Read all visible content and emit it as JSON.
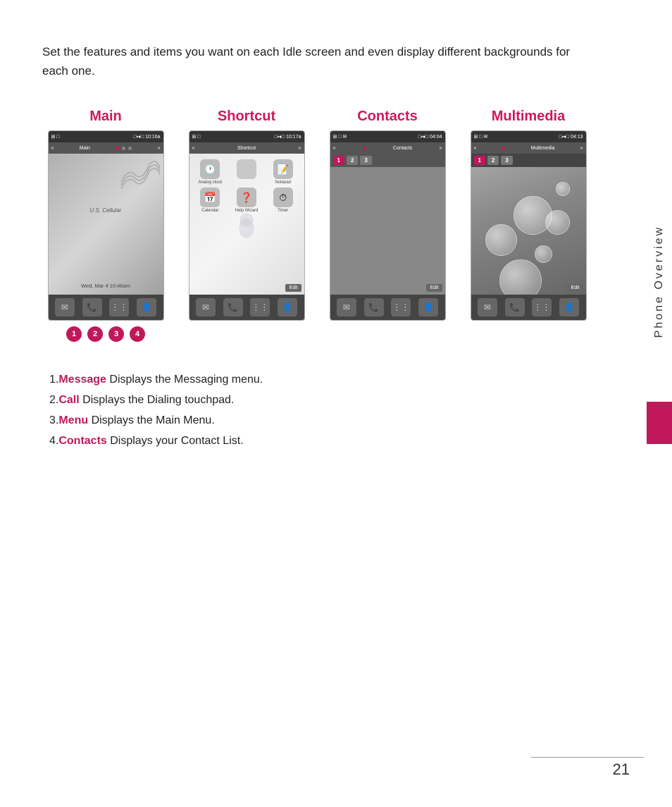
{
  "intro": {
    "text": "Set the features and items you want on each Idle screen and even display different backgrounds for each one."
  },
  "screens": [
    {
      "id": "main",
      "label": "Main",
      "type": "main",
      "status_left": "⊞ □",
      "status_right": "□▪♦□ 10:16a",
      "nav_label": "Main",
      "content_line1": "U.S. Cellular",
      "content_line2": "Wed, Mar 4  10:46am",
      "show_circles": true
    },
    {
      "id": "shortcut",
      "label": "Shortcut",
      "type": "shortcut",
      "status_right": "10:17a",
      "nav_label": "Shortcut",
      "apps": [
        {
          "icon": "🕐",
          "label": "Analog clock"
        },
        {
          "icon": "📝",
          "label": "Timer"
        },
        {
          "icon": "📔",
          "label": "Notepad"
        },
        {
          "icon": "📅",
          "label": "Calendar"
        },
        {
          "icon": "❓",
          "label": "Help Wizard"
        }
      ]
    },
    {
      "id": "contacts",
      "label": "Contacts",
      "type": "contacts",
      "status_right": "04:04",
      "nav_label": "Contacts",
      "tabs": [
        "1",
        "2",
        "3"
      ]
    },
    {
      "id": "multimedia",
      "label": "Multimedia",
      "type": "multimedia",
      "status_right": "04:13",
      "nav_label": "Multimedia",
      "tabs": [
        "1",
        "2",
        "3"
      ]
    }
  ],
  "circles": [
    "1",
    "2",
    "3",
    "4"
  ],
  "legend": [
    {
      "number": "1",
      "label": "Message",
      "description": " Displays the Messaging menu."
    },
    {
      "number": "2",
      "label": "Call",
      "description": " Displays the Dialing touchpad."
    },
    {
      "number": "3",
      "label": "Menu",
      "description": " Displays the Main Menu."
    },
    {
      "number": "4",
      "label": "Contacts",
      "description": " Displays your Contact List."
    }
  ],
  "side_label": "Phone Overview",
  "page_number": "21",
  "accent_color": "#c0185a"
}
